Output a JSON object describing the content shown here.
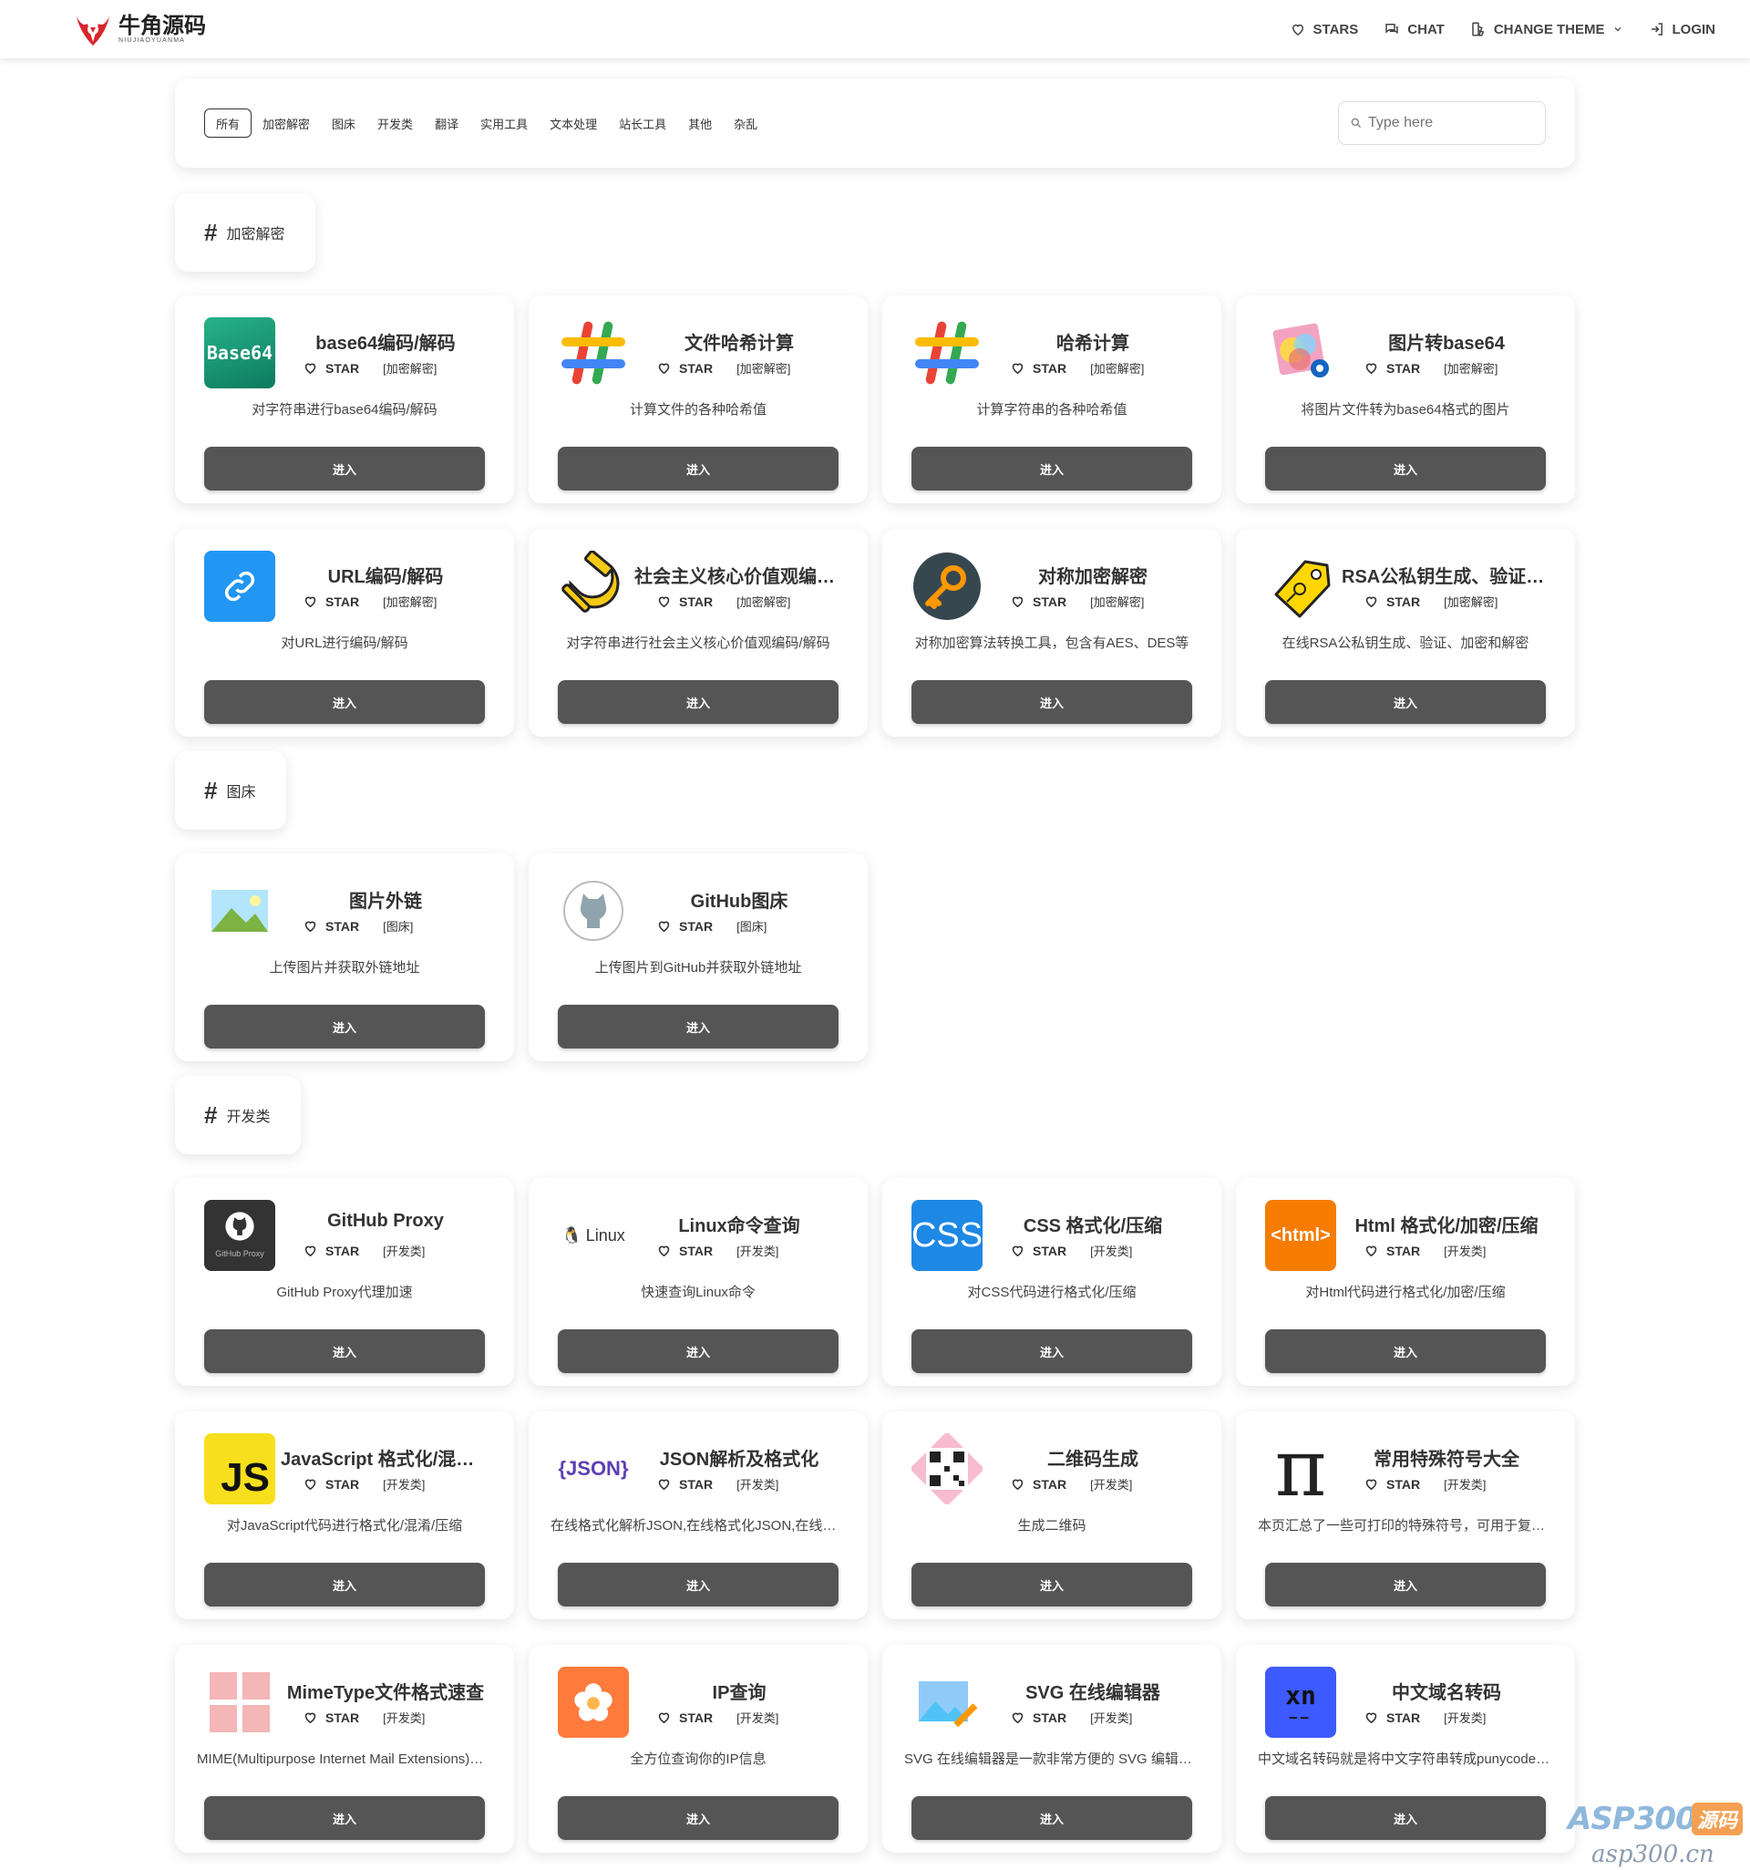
{
  "header": {
    "logo_title": "牛角源码",
    "logo_subtitle": "NIUJIAOYUANMA",
    "nav": {
      "stars": "STARS",
      "chat": "CHAT",
      "change_theme": "CHANGE THEME",
      "login": "LOGIN"
    }
  },
  "filters": {
    "items": [
      "所有",
      "加密解密",
      "图床",
      "开发类",
      "翻译",
      "实用工具",
      "文本处理",
      "站长工具",
      "其他",
      "杂乱"
    ],
    "active_index": 0,
    "search_placeholder": "Type here"
  },
  "common": {
    "star_label": "STAR",
    "enter_label": "进入"
  },
  "sections": [
    {
      "tag": "加密解密",
      "cards": [
        {
          "title": "base64编码/解码",
          "category": "[加密解密]",
          "desc": "对字符串进行base64编码/解码",
          "icon": "base64-icon"
        },
        {
          "title": "文件哈希计算",
          "category": "[加密解密]",
          "desc": "计算文件的各种哈希值",
          "icon": "hash-icon"
        },
        {
          "title": "哈希计算",
          "category": "[加密解密]",
          "desc": "计算字符串的各种哈希值",
          "icon": "hash-icon"
        },
        {
          "title": "图片转base64",
          "category": "[加密解密]",
          "desc": "将图片文件转为base64格式的图片",
          "icon": "image-icon"
        },
        {
          "title": "URL编码/解码",
          "category": "[加密解密]",
          "desc": "对URL进行编码/解码",
          "icon": "link-icon"
        },
        {
          "title": "社会主义核心价值观编码/解码",
          "category": "[加密解密]",
          "desc": "对字符串进行社会主义核心价值观编码/解码",
          "icon": "hammer-sickle-icon"
        },
        {
          "title": "对称加密解密",
          "category": "[加密解密]",
          "desc": "对称加密算法转换工具，包含有AES、DES等",
          "icon": "key-icon"
        },
        {
          "title": "RSA公私钥生成、验证、加密和解密",
          "category": "[加密解密]",
          "desc": "在线RSA公私钥生成、验证、加密和解密",
          "icon": "tag-key-icon"
        }
      ]
    },
    {
      "tag": "图床",
      "cards": [
        {
          "title": "图片外链",
          "category": "[图床]",
          "desc": "上传图片并获取外链地址",
          "icon": "landscape-icon"
        },
        {
          "title": "GitHub图床",
          "category": "[图床]",
          "desc": "上传图片到GitHub并获取外链地址",
          "icon": "github-cat-icon"
        }
      ]
    },
    {
      "tag": "开发类",
      "cards": [
        {
          "title": "GitHub Proxy",
          "category": "[开发类]",
          "desc": "GitHub Proxy代理加速",
          "icon": "github-proxy-icon",
          "icon_caption": "GitHub Proxy"
        },
        {
          "title": "Linux命令查询",
          "category": "[开发类]",
          "desc": "快速查询Linux命令",
          "icon": "linux-icon",
          "icon_caption": "Linux"
        },
        {
          "title": "CSS 格式化/压缩",
          "category": "[开发类]",
          "desc": "对CSS代码进行格式化/压缩",
          "icon": "css-icon",
          "icon_caption": "CSS"
        },
        {
          "title": "Html 格式化/加密/压缩",
          "category": "[开发类]",
          "desc": "对Html代码进行格式化/加密/压缩",
          "icon": "html-icon",
          "icon_caption": "<html>"
        },
        {
          "title": "JavaScript 格式化/混淆/压缩",
          "category": "[开发类]",
          "desc": "对JavaScript代码进行格式化/混淆/压缩",
          "icon": "js-icon",
          "icon_caption": "JS"
        },
        {
          "title": "JSON解析及格式化",
          "category": "[开发类]",
          "desc": "在线格式化解析JSON,在线格式化JSON,在线压缩JSON",
          "icon": "json-icon",
          "icon_caption": "{JSON}"
        },
        {
          "title": "二维码生成",
          "category": "[开发类]",
          "desc": "生成二维码",
          "icon": "qrcode-icon"
        },
        {
          "title": "常用特殊符号大全",
          "category": "[开发类]",
          "desc": "本页汇总了一些可打印的特殊符号，可用于复制粘贴",
          "icon": "pi-icon"
        },
        {
          "title": "MimeType文件格式速查",
          "category": "[开发类]",
          "desc": "MIME(Multipurpose Internet Mail Extensions)多用途互联网邮件扩展类型",
          "icon": "grid-icon"
        },
        {
          "title": "IP查询",
          "category": "[开发类]",
          "desc": "全方位查询你的IP信息",
          "icon": "flower-icon"
        },
        {
          "title": "SVG 在线编辑器",
          "category": "[开发类]",
          "desc": "SVG 在线编辑器是一款非常方便的 SVG 编辑工具",
          "icon": "svg-edit-icon"
        },
        {
          "title": "中文域名转码",
          "category": "[开发类]",
          "desc": "中文域名转码就是将中文字符串转成punycode编码",
          "icon": "xn-icon",
          "icon_caption": "xn"
        }
      ]
    }
  ],
  "watermark": {
    "main": "ASP300",
    "badge": "源码",
    "sub": "asp300.cn"
  },
  "colors": {
    "button_bg": "#555555",
    "base64_green": "#1a9a78",
    "link_blue": "#2196f3",
    "css_blue": "#1e88e5",
    "html_orange": "#f57c00",
    "js_yellow": "#f7df1e"
  }
}
